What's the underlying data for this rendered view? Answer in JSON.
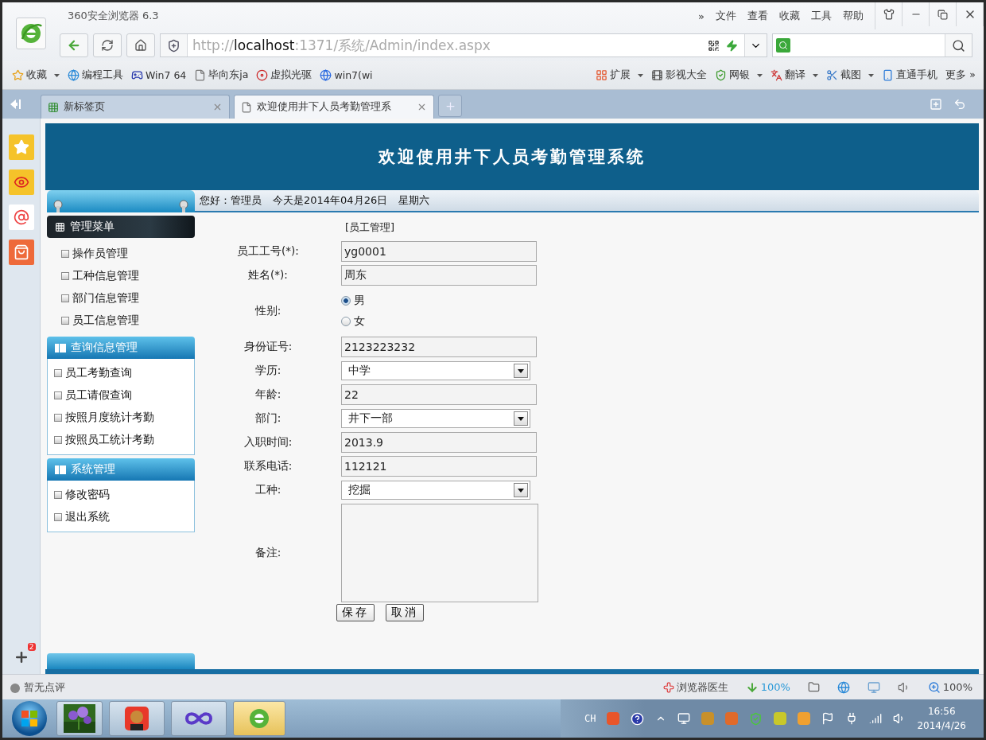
{
  "browser": {
    "title": "360安全浏览器 6.3",
    "menu": [
      "»",
      "文件",
      "查看",
      "收藏",
      "工具",
      "帮助"
    ],
    "url": "http://**localhost**:1371/系统/Admin/index.aspx"
  },
  "bookmarks": [
    {
      "label": "收藏",
      "dropdown": true
    },
    {
      "label": "编程工具",
      "dropdown": false
    },
    {
      "label": "Win7 64",
      "dropdown": false
    },
    {
      "label": "毕向东ja",
      "dropdown": false
    },
    {
      "label": "虚拟光驱",
      "dropdown": false
    },
    {
      "label": "win7(wi",
      "dropdown": false
    }
  ],
  "extensions": [
    {
      "label": "扩展",
      "dropdown": true
    },
    {
      "label": "影视大全",
      "dropdown": false
    },
    {
      "label": "网银",
      "dropdown": true
    },
    {
      "label": "翻译",
      "dropdown": true
    },
    {
      "label": "截图",
      "dropdown": true
    },
    {
      "label": "直通手机",
      "dropdown": false
    }
  ],
  "more": "更多 »",
  "tabs": [
    {
      "label": "新标签页",
      "selected": false
    },
    {
      "label": "欢迎使用井下人员考勤管理系",
      "selected": true
    }
  ],
  "sidebar": {
    "badge": "2"
  },
  "page": {
    "banner": "欢迎使用井下人员考勤管理系统",
    "greeting": "您好：管理员",
    "date": "今天是2014年04月26日",
    "weekday": "星期六"
  },
  "menu": [
    {
      "title": "管理菜单",
      "kind": "dark",
      "items": [
        "操作员管理",
        "工种信息管理",
        "部门信息管理",
        "员工信息管理"
      ]
    },
    {
      "title": "查询信息管理",
      "kind": "blue",
      "items": [
        "员工考勤查询",
        "员工请假查询",
        "按照月度统计考勤",
        "按照员工统计考勤"
      ]
    },
    {
      "title": "系统管理",
      "kind": "blue",
      "items": [
        "修改密码",
        "退出系统"
      ]
    }
  ],
  "form": {
    "title": "[员工管理]",
    "fields": [
      {
        "label": "员工工号(*):",
        "kind": "text",
        "value": "yg0001"
      },
      {
        "label": "姓名(*):",
        "kind": "text",
        "value": "周东"
      },
      {
        "label": "性别:",
        "kind": "radio",
        "options": [
          {
            "label": "男",
            "selected": true
          },
          {
            "label": "女",
            "selected": false
          }
        ]
      },
      {
        "label": "身份证号:",
        "kind": "text",
        "value": "2123223232"
      },
      {
        "label": "学历:",
        "kind": "select",
        "value": "中学"
      },
      {
        "label": "年龄:",
        "kind": "text",
        "value": "22"
      },
      {
        "label": "部门:",
        "kind": "select",
        "value": "井下一部"
      },
      {
        "label": "入职时间:",
        "kind": "text",
        "value": "2013.9"
      },
      {
        "label": "联系电话:",
        "kind": "text",
        "value": "112121"
      },
      {
        "label": "工种:",
        "kind": "select",
        "value": "挖掘"
      },
      {
        "label": "备注:",
        "kind": "textarea"
      }
    ],
    "buttons": [
      "保存",
      "取消"
    ]
  },
  "status_bar": {
    "comment": "暂无点评",
    "doctor": "浏览器医生",
    "download": "100%",
    "zoom": "100%"
  },
  "taskbar": {
    "ime": "CH",
    "time": "16:56",
    "date": "2014/4/26"
  }
}
